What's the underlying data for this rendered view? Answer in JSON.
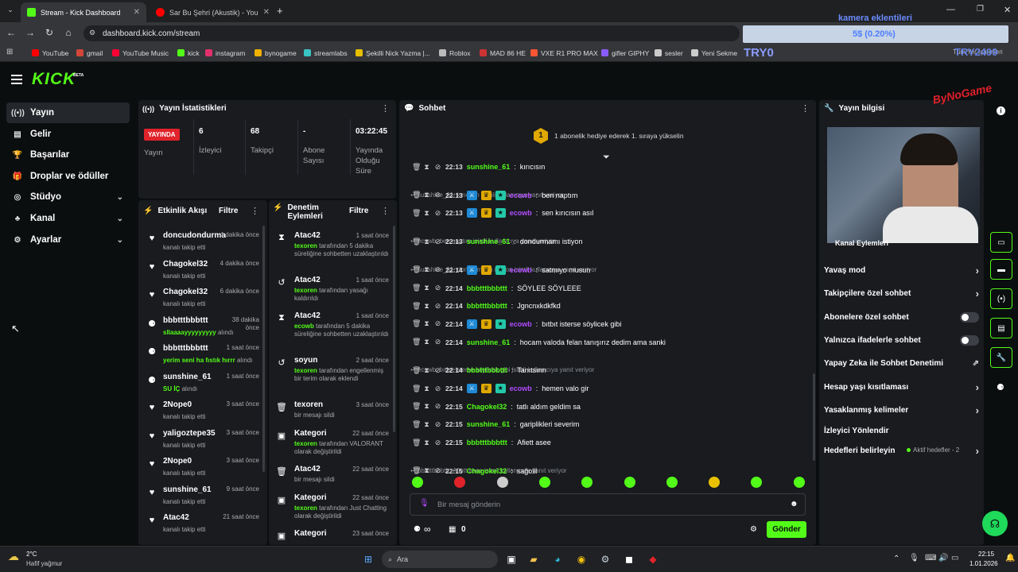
{
  "browser": {
    "tabs": [
      {
        "title": "Stream - Kick Dashboard"
      },
      {
        "title": "Sar Bu Şehri (Akustik) - You"
      }
    ],
    "url": "dashboard.kick.com/stream",
    "bookmarks": [
      "YouTube",
      "gmail",
      "YouTube Music",
      "kick",
      "instagram",
      "bynogame",
      "streamlabs",
      "Şekilli Nick Yazma |...",
      "Roblox",
      "MAD 86 HE",
      "VXE R1 PRO MAX",
      "gifler GIPHY",
      "sesler",
      "Yeni Sekme"
    ]
  },
  "overlay": {
    "goal_title": "kamera eklentileri",
    "goal_value": "5$ (0.20%)",
    "tag1": "TRY0",
    "tag2": "TRY2499",
    "tag3": "Tüm Yer İşaretleri"
  },
  "brand": {
    "logo": "KICK",
    "beta": "BETA"
  },
  "sidebar": {
    "items": [
      {
        "label": "Yayın",
        "icon": "broadcast-icon"
      },
      {
        "label": "Gelir",
        "icon": "revenue-icon"
      },
      {
        "label": "Başarılar",
        "icon": "trophy-icon"
      },
      {
        "label": "Droplar ve ödüller",
        "icon": "gift-icon"
      },
      {
        "label": "Stüdyo",
        "icon": "studio-icon"
      },
      {
        "label": "Kanal",
        "icon": "channel-icon"
      },
      {
        "label": "Ayarlar",
        "icon": "settings-icon"
      }
    ]
  },
  "stats": {
    "title": "Yayın İstatistikleri",
    "live_badge": "YAYINDA",
    "live_label": "Yayın",
    "viewers": {
      "value": "6",
      "label": "İzleyici"
    },
    "followers": {
      "value": "68",
      "label": "Takipçi"
    },
    "subs": {
      "value": "-",
      "label": "Abone Sayısı"
    },
    "uptime": {
      "value": "03:22:45",
      "label": "Yayında Olduğu Süre"
    }
  },
  "activity": {
    "title": "Etkinlik Akışı",
    "filter": "Filtre",
    "items": [
      {
        "name": "doncudondurma",
        "time": "4 dakika önce",
        "sub": "kanalı takip etti",
        "highlight": "",
        "icon": "heart-icon"
      },
      {
        "name": "Chagokel32",
        "time": "4 dakika önce",
        "sub": "kanalı takip etti",
        "highlight": "",
        "icon": "heart-icon"
      },
      {
        "name": "Chagokel32",
        "time": "6 dakika önce",
        "sub": "kanalı takip etti",
        "highlight": "",
        "icon": "heart-icon"
      },
      {
        "name": "bbbtttbbbttt",
        "time": "38 dakika önce",
        "sub": "alındı",
        "highlight": "sllaaaayyyyyyyyy",
        "icon": "reward-icon"
      },
      {
        "name": "bbbtttbbbttt",
        "time": "1 saat önce",
        "sub": "alındı",
        "highlight": "yerim seni ha fıstık hırrr",
        "icon": "reward-icon"
      },
      {
        "name": "sunshine_61",
        "time": "1 saat önce",
        "sub": "alındı",
        "highlight": "SU İÇ",
        "icon": "reward-icon"
      },
      {
        "name": "2Nope0",
        "time": "3 saat önce",
        "sub": "kanalı takip etti",
        "highlight": "",
        "icon": "heart-icon"
      },
      {
        "name": "yaligoztepe35",
        "time": "3 saat önce",
        "sub": "kanalı takip etti",
        "highlight": "",
        "icon": "heart-icon"
      },
      {
        "name": "2Nope0",
        "time": "3 saat önce",
        "sub": "kanalı takip etti",
        "highlight": "",
        "icon": "heart-icon"
      },
      {
        "name": "sunshine_61",
        "time": "9 saat önce",
        "sub": "kanalı takip etti",
        "highlight": "",
        "icon": "heart-icon"
      },
      {
        "name": "Atac42",
        "time": "21 saat önce",
        "sub": "kanalı takip etti",
        "highlight": "",
        "icon": "heart-icon"
      }
    ]
  },
  "moderation": {
    "title": "Denetim Eylemleri",
    "filter": "Filtre",
    "items": [
      {
        "name": "Atac42",
        "time": "1 saat önce",
        "user": "texoren",
        "rest": " tarafından 5 dakika süreliğine sohbetten uzaklaştırıldı",
        "icon": "hourglass-icon"
      },
      {
        "name": "Atac42",
        "time": "1 saat önce",
        "user": "texoren",
        "rest": " tarafından yasağı kaldırıldı",
        "icon": "undo-icon"
      },
      {
        "name": "Atac42",
        "time": "1 saat önce",
        "user": "ecowb",
        "rest": " tarafından 5 dakika süreliğine sohbetten uzaklaştırıldı",
        "icon": "hourglass-icon"
      },
      {
        "name": "soyun",
        "time": "2 saat önce",
        "user": "texoren",
        "rest": " tarafından engellenmiş bir terim olarak eklendi",
        "icon": "undo-icon"
      },
      {
        "name": "texoren",
        "time": "3 saat önce",
        "user": "",
        "rest": "bir mesajı sildi",
        "icon": "trash-icon"
      },
      {
        "name": "Kategori",
        "time": "22 saat önce",
        "user": "texoren",
        "rest": " tarafından VALORANT olarak değiştirildi",
        "icon": "category-icon"
      },
      {
        "name": "Atac42",
        "time": "22 saat önce",
        "user": "",
        "rest": "bir mesajı sildi",
        "icon": "trash-icon"
      },
      {
        "name": "Kategori",
        "time": "22 saat önce",
        "user": "texoren",
        "rest": " tarafından Just Chatting olarak değiştirildi",
        "icon": "category-icon"
      },
      {
        "name": "Kategori",
        "time": "23 saat önce",
        "user": "",
        "rest": "",
        "icon": "category-icon"
      }
    ]
  },
  "chat": {
    "title": "Sohbet",
    "gift_banner": "1 abonelik hediye ederek 1. sıraya yükselin",
    "gift_rank": "1",
    "messages": [
      {
        "type": "msg",
        "time": "22:13",
        "user": "sunshine_61",
        "color": "#53fc18",
        "badges": false,
        "text": "kırıcısın"
      },
      {
        "type": "reply",
        "text": "sunshine_61: kırıcısın isimli kullanıcıya yanıt veriyor"
      },
      {
        "type": "msg",
        "time": "22:13",
        "user": "ecowb",
        "color": "#53fc18",
        "badges": true,
        "text": "ben naptım"
      },
      {
        "type": "msg",
        "time": "22:13",
        "user": "ecowb",
        "color": "#53fc18",
        "badges": true,
        "text": "sen kırıcısın asıl"
      },
      {
        "type": "reply",
        "text": "ecowb: ben naptım isimli kullanıcıya yanıt veriyor"
      },
      {
        "type": "msg",
        "time": "22:13",
        "user": "sunshine_61",
        "color": "#53fc18",
        "badges": false,
        "text": "dondurmamı istiyon"
      },
      {
        "type": "reply",
        "text": "sunshine_61: dondurmamı istiyon isimli kullanıcıya yanıt veriyor"
      },
      {
        "type": "msg",
        "time": "22:14",
        "user": "ecowb",
        "color": "#53fc18",
        "badges": true,
        "text": "satmıyo musun"
      },
      {
        "type": "msg",
        "time": "22:14",
        "user": "bbbtttbbbttt",
        "color": "#53fc18",
        "badges": false,
        "text": "SÖYLEE SÖYLEEE"
      },
      {
        "type": "msg",
        "time": "22:14",
        "user": "bbbtttbbbttt",
        "color": "#53fc18",
        "badges": false,
        "text": "Jgncnxkdkfkd"
      },
      {
        "type": "msg",
        "time": "22:14",
        "user": "ecowb",
        "color": "#53fc18",
        "badges": true,
        "text": "bıtbıt isterse söylicek gibi"
      },
      {
        "type": "msg",
        "time": "22:14",
        "user": "sunshine_61",
        "color": "#53fc18",
        "badges": false,
        "text": "hocam valoda felan tanışırız dedim ama sanki"
      },
      {
        "type": "reply",
        "text": "ecowb: bıtbıt isterse söylicek gibi isimli kullanıcıya yanıt veriyor"
      },
      {
        "type": "msg",
        "time": "22:14",
        "user": "bbbtttbbbttt",
        "color": "#53fc18",
        "badges": false,
        "text": "Tanıtsınn"
      },
      {
        "type": "msg",
        "time": "22:14",
        "user": "ecowb",
        "color": "#53fc18",
        "badges": true,
        "text": "hemen valo gir"
      },
      {
        "type": "msg",
        "time": "22:15",
        "user": "Chagokel32",
        "color": "#53fc18",
        "badges": false,
        "text": "tatlı aldım geldim sa"
      },
      {
        "type": "msg",
        "time": "22:15",
        "user": "sunshine_61",
        "color": "#53fc18",
        "badges": false,
        "text": "gariplikleri severim"
      },
      {
        "type": "msg",
        "time": "22:15",
        "user": "bbbtttbbbttt",
        "color": "#53fc18",
        "badges": false,
        "text": "Afiett asee"
      },
      {
        "type": "reply",
        "text": "bbbtttbbbttt: Afiett asee isimli kullanıcıya yanıt veriyor"
      },
      {
        "type": "msg",
        "time": "22:15",
        "user": "Chagokel32",
        "color": "#53fc18",
        "badges": false,
        "text": "sağolll"
      }
    ],
    "input_placeholder": "Bir mesaj gönderin",
    "points": "∞",
    "store_count": "0",
    "send_label": "Gönder"
  },
  "stream_info": {
    "title": "Yayın bilgisi",
    "actions_title": "Kanal Eylemleri",
    "rows": [
      {
        "label": "Yavaş mod",
        "kind": "arrow"
      },
      {
        "label": "Takipçilere özel sohbet",
        "kind": "arrow"
      },
      {
        "label": "Abonelere özel sohbet",
        "kind": "toggle"
      },
      {
        "label": "Yalnızca ifadelerle sohbet",
        "kind": "toggle"
      },
      {
        "label": "Yapay Zeka ile Sohbet Denetimi",
        "kind": "external"
      },
      {
        "label": "Hesap yaşı kısıtlaması",
        "kind": "arrow"
      },
      {
        "label": "Yasaklanmış kelimeler",
        "kind": "arrow"
      },
      {
        "label": "İzleyici Yönlendir",
        "kind": "none"
      },
      {
        "label": "Hedefleri belirleyin",
        "kind": "arrow"
      }
    ],
    "goal_status": "Aktif hedefler - 2"
  },
  "taskbar": {
    "weather_temp": "2°C",
    "weather_desc": "Hafif yağmur",
    "search": "Ara",
    "time": "22:15",
    "date": "1.01.2026"
  },
  "colors": {
    "accent": "#53fc18",
    "panel": "#191b1f",
    "bg": "#0b0e0f"
  }
}
